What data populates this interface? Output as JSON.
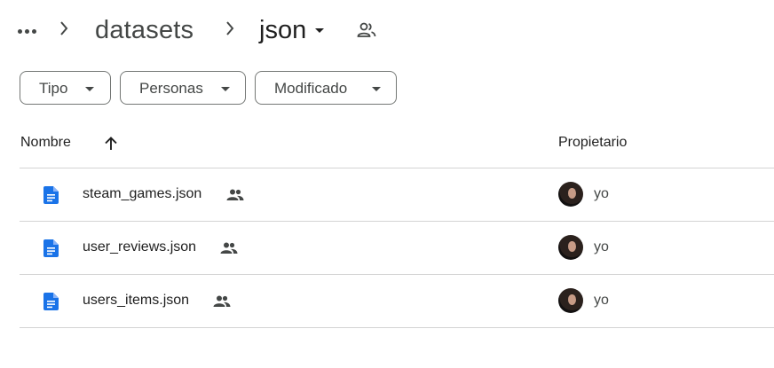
{
  "breadcrumb": {
    "more_label": "More",
    "parent": "datasets",
    "current": "json",
    "shared_icon": "people-icon"
  },
  "filters": [
    {
      "label": "Tipo"
    },
    {
      "label": "Personas"
    },
    {
      "label": "Modificado"
    }
  ],
  "columns": {
    "name": "Nombre",
    "owner": "Propietario",
    "sort_icon": "arrow-up-icon"
  },
  "files": [
    {
      "name": "steam_games.json",
      "owner": "yo",
      "icon": "doc-icon",
      "shared_icon": "people-icon"
    },
    {
      "name": "user_reviews.json",
      "owner": "yo",
      "icon": "doc-icon",
      "shared_icon": "people-icon"
    },
    {
      "name": "users_items.json",
      "owner": "yo",
      "icon": "doc-icon",
      "shared_icon": "people-icon"
    }
  ],
  "colors": {
    "doc_icon": "#1a73e8",
    "text": "#1f1f1f",
    "secondary": "#444746",
    "divider": "#d3d3d3"
  }
}
